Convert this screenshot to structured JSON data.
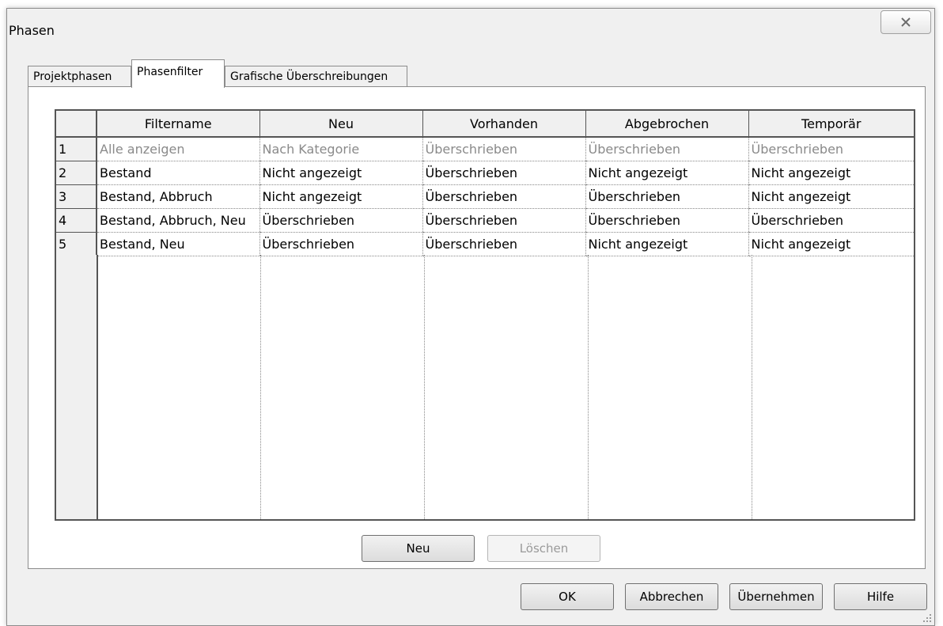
{
  "window": {
    "title": "Phasen"
  },
  "tabs": [
    {
      "label": "Projektphasen",
      "active": false
    },
    {
      "label": "Phasenfilter",
      "active": true
    },
    {
      "label": "Grafische Überschreibungen",
      "active": false
    }
  ],
  "grid": {
    "columns": [
      "Filtername",
      "Neu",
      "Vorhanden",
      "Abgebrochen",
      "Temporär"
    ],
    "rows": [
      {
        "num": "1",
        "cells": [
          "Alle anzeigen",
          "Nach Kategorie",
          "Überschrieben",
          "Überschrieben",
          "Überschrieben"
        ],
        "disabled": true
      },
      {
        "num": "2",
        "cells": [
          "Bestand",
          "Nicht angezeigt",
          "Überschrieben",
          "Nicht angezeigt",
          "Nicht angezeigt"
        ]
      },
      {
        "num": "3",
        "cells": [
          "Bestand, Abbruch",
          "Nicht angezeigt",
          "Überschrieben",
          "Überschrieben",
          "Nicht angezeigt"
        ]
      },
      {
        "num": "4",
        "cells": [
          "Bestand, Abbruch, Neu",
          "Überschrieben",
          "Überschrieben",
          "Überschrieben",
          "Überschrieben"
        ]
      },
      {
        "num": "5",
        "cells": [
          "Bestand, Neu",
          "Überschrieben",
          "Überschrieben",
          "Nicht angezeigt",
          "Nicht angezeigt"
        ]
      }
    ]
  },
  "panel_buttons": {
    "new_label": "Neu",
    "delete_label": "Löschen"
  },
  "footer_buttons": {
    "ok_label": "OK",
    "cancel_label": "Abbrechen",
    "apply_label": "Übernehmen",
    "help_label": "Hilfe"
  },
  "icons": {
    "close": "close-icon",
    "resize": "resize-grip-icon"
  }
}
